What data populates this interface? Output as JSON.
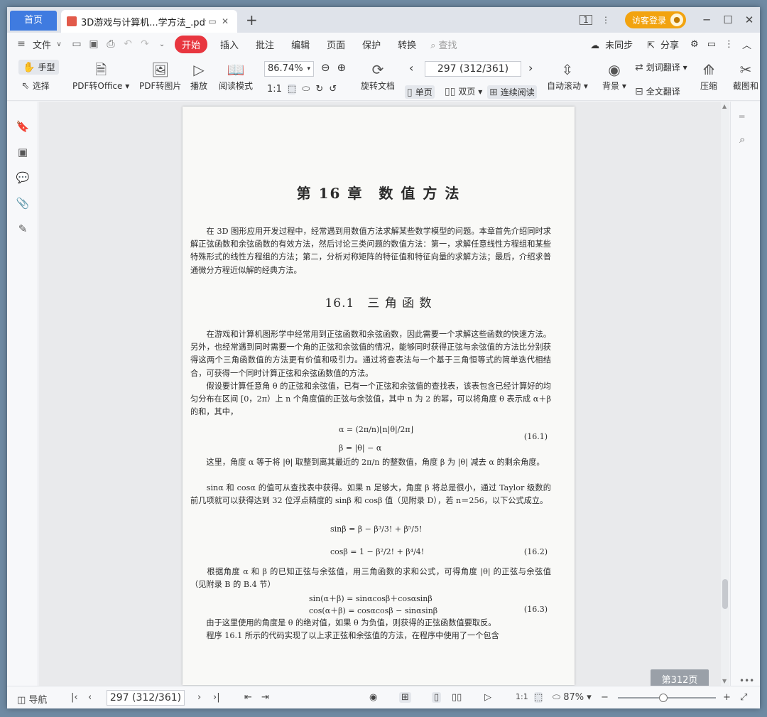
{
  "tabs": {
    "home": "首页",
    "doc_title": "3D游戏与计算机...学方法_.pdf",
    "new_tab": "+"
  },
  "window": {
    "login": "访客登录",
    "sidebar_ico": "1"
  },
  "menu": {
    "file": "文件",
    "items": [
      "开始",
      "插入",
      "批注",
      "编辑",
      "页面",
      "保护",
      "转换"
    ],
    "search": "查找",
    "sync": "未同步",
    "share": "分享"
  },
  "ribbon": {
    "hand": "手型",
    "select": "选择",
    "pdf_office": "PDF转Office",
    "pdf_image": "PDF转图片",
    "play": "播放",
    "read_mode": "阅读模式",
    "zoom": "86.74%",
    "rotate": "旋转文档",
    "page": "297 (312/361)",
    "single": "单页",
    "double": "双页",
    "continuous": "连续阅读",
    "autoscroll": "自动滚动",
    "bg": "背景",
    "word_translate": "划词翻译",
    "full_translate": "全文翻译",
    "compress": "压缩",
    "screenshot": "截图和"
  },
  "document": {
    "chapter": "第 16 章　数 值 方 法",
    "intro": "　　在 3D 图形应用开发过程中，经常遇到用数值方法求解某些数学模型的问题。本章首先介绍同时求解正弦函数和余弦函数的有效方法，然后讨论三类问题的数值方法：第一，求解任意线性方程组和某些特殊形式的线性方程组的方法；第二，分析对称矩阵的特征值和特征向量的求解方法；最后，介绍求普通微分方程近似解的经典方法。",
    "section": "16.1　三 角 函 数",
    "p1": "　　在游戏和计算机图形学中经常用到正弦函数和余弦函数，因此需要一个求解这些函数的快速方法。另外，也经常遇到同时需要一个角的正弦和余弦值的情况，能够同时获得正弦与余弦值的方法比分别获得这两个三角函数值的方法更有价值和吸引力。通过将查表法与一个基于三角恒等式的简单迭代相结合，可获得一个同时计算正弦和余弦函数值的方法。",
    "p2": "　　假设要计算任意角 θ 的正弦和余弦值，已有一个正弦和余弦值的查找表，该表包含已经计算好的均匀分布在区间 [0，2π）上 n 个角度值的正弦与余弦值，其中 n 为 2 的幂，可以将角度 θ 表示成 α＋β 的和，其中，",
    "eq1a": "α = (2π/n)⌊n|θ|/2π⌋",
    "eq1b": "β = |θ| − α",
    "eq1n": "(16.1)",
    "p3": "　　这里，角度 α 等于将 |θ| 取整到离其最近的 2π/n 的整数值，角度 β 为 |θ| 减去 α 的剩余角度。",
    "p4": "　　sinα 和 cosα 的值可从查找表中获得。如果 n 足够大，角度 β 将总是很小，通过 Taylor 级数的前几项就可以获得达到 32 位浮点精度的 sinβ 和 cosβ 值（见附录 D），若 n＝256，以下公式成立。",
    "eq2a": "sinβ = β − β³/3! + β⁵/5!",
    "eq2b": "cosβ = 1 − β²/2! + β⁴/4!",
    "eq2n": "(16.2)",
    "p5": "　　根据角度 α 和 β 的已知正弦与余弦值，用三角函数的求和公式，可得角度 |θ| 的正弦与余弦值（见附录 B 的 B.4 节）",
    "eq3a": "sin(α＋β) = sinαcosβ＋cosαsinβ",
    "eq3b": "cos(α＋β) = cosαcosβ − sinαsinβ",
    "eq3n": "(16.3)",
    "p6": "　　由于这里使用的角度是 θ 的绝对值，如果 θ 为负值，则获得的正弦函数值要取反。",
    "p7": "　　程序 16.1 所示的代码实现了以上求正弦和余弦值的方法，在程序中使用了一个包含"
  },
  "page_badge": "第312页",
  "status": {
    "nav": "导航",
    "page": "297 (312/361)",
    "zoom": "87%"
  }
}
